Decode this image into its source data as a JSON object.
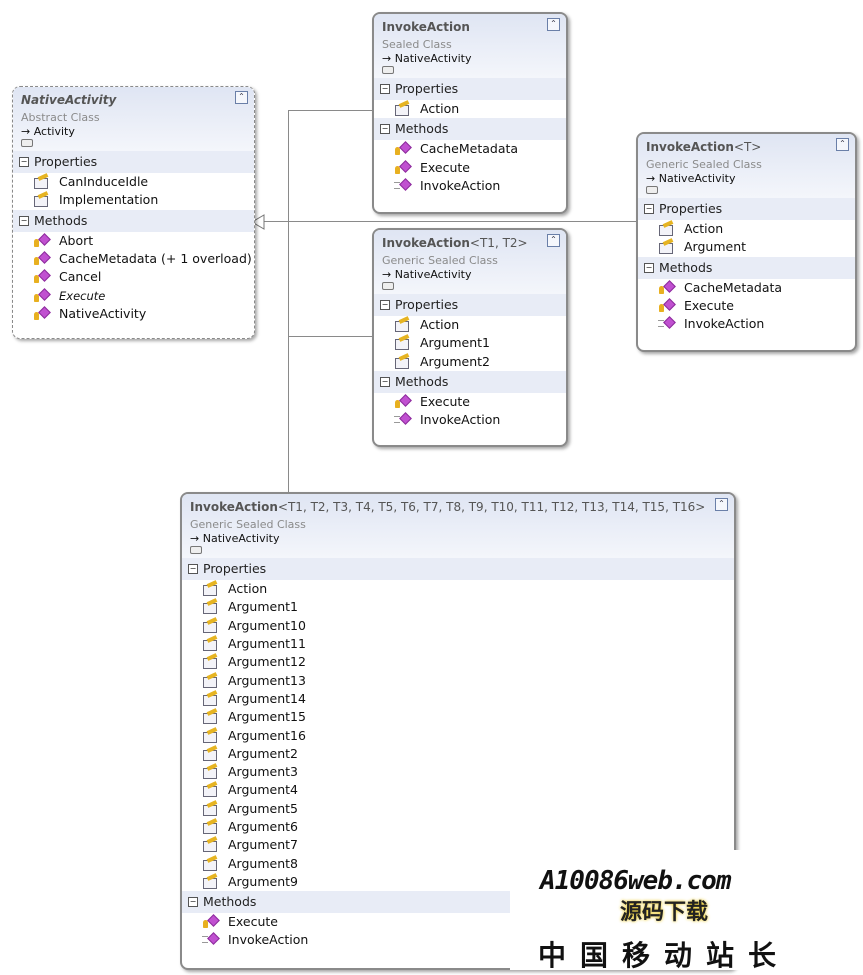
{
  "colors": {
    "border": "#8a8a8a",
    "header_bg": "#dfe5f3",
    "section_bg": "#e8ecf6",
    "method_icon": "#c050d0",
    "property_icon": "#e6b422"
  },
  "collapse_glyph": "⌃",
  "section_toggle_glyph": "−",
  "classes": [
    {
      "id": "native-activity",
      "name": "NativeActivity",
      "type_params": "",
      "italic": true,
      "abstract": true,
      "kind": "Abstract Class",
      "base": "Activity",
      "sections": [
        {
          "label": "Properties",
          "items": [
            {
              "label": "CanInduceIdle",
              "icon": "property-icon"
            },
            {
              "label": "Implementation",
              "icon": "property-icon"
            }
          ]
        },
        {
          "label": "Methods",
          "items": [
            {
              "label": "Abort",
              "icon": "protected-method-icon"
            },
            {
              "label": "CacheMetadata (+ 1 overload)",
              "icon": "protected-method-icon"
            },
            {
              "label": "Cancel",
              "icon": "protected-method-icon"
            },
            {
              "label": "Execute",
              "icon": "protected-method-icon",
              "italic": true
            },
            {
              "label": "NativeActivity",
              "icon": "protected-method-icon"
            }
          ]
        }
      ]
    },
    {
      "id": "invoke-action",
      "name": "InvokeAction",
      "type_params": "",
      "kind": "Sealed Class",
      "base": "NativeActivity",
      "sections": [
        {
          "label": "Properties",
          "items": [
            {
              "label": "Action",
              "icon": "property-icon"
            }
          ]
        },
        {
          "label": "Methods",
          "items": [
            {
              "label": "CacheMetadata",
              "icon": "protected-method-icon"
            },
            {
              "label": "Execute",
              "icon": "protected-method-icon"
            },
            {
              "label": "InvokeAction",
              "icon": "public-method-icon"
            }
          ]
        }
      ]
    },
    {
      "id": "invoke-action-t",
      "name": "InvokeAction",
      "type_params": "<T>",
      "kind": "Generic Sealed Class",
      "base": "NativeActivity",
      "sections": [
        {
          "label": "Properties",
          "items": [
            {
              "label": "Action",
              "icon": "property-icon"
            },
            {
              "label": "Argument",
              "icon": "property-icon"
            }
          ]
        },
        {
          "label": "Methods",
          "items": [
            {
              "label": "CacheMetadata",
              "icon": "protected-method-icon"
            },
            {
              "label": "Execute",
              "icon": "protected-method-icon"
            },
            {
              "label": "InvokeAction",
              "icon": "public-method-icon"
            }
          ]
        }
      ]
    },
    {
      "id": "invoke-action-t1-t2",
      "name": "InvokeAction",
      "type_params": "<T1, T2>",
      "kind": "Generic Sealed Class",
      "base": "NativeActivity",
      "sections": [
        {
          "label": "Properties",
          "items": [
            {
              "label": "Action",
              "icon": "property-icon"
            },
            {
              "label": "Argument1",
              "icon": "property-icon"
            },
            {
              "label": "Argument2",
              "icon": "property-icon"
            }
          ]
        },
        {
          "label": "Methods",
          "items": [
            {
              "label": "Execute",
              "icon": "protected-method-icon"
            },
            {
              "label": "InvokeAction",
              "icon": "public-method-icon"
            }
          ]
        }
      ]
    },
    {
      "id": "invoke-action-t1-t16",
      "name": "InvokeAction",
      "type_params": "<T1, T2, T3, T4, T5, T6, T7, T8, T9, T10, T11, T12, T13, T14, T15, T16>",
      "kind": "Generic Sealed Class",
      "base": "NativeActivity",
      "sections": [
        {
          "label": "Properties",
          "items": [
            {
              "label": "Action",
              "icon": "property-icon"
            },
            {
              "label": "Argument1",
              "icon": "property-icon"
            },
            {
              "label": "Argument10",
              "icon": "property-icon"
            },
            {
              "label": "Argument11",
              "icon": "property-icon"
            },
            {
              "label": "Argument12",
              "icon": "property-icon"
            },
            {
              "label": "Argument13",
              "icon": "property-icon"
            },
            {
              "label": "Argument14",
              "icon": "property-icon"
            },
            {
              "label": "Argument15",
              "icon": "property-icon"
            },
            {
              "label": "Argument16",
              "icon": "property-icon"
            },
            {
              "label": "Argument2",
              "icon": "property-icon"
            },
            {
              "label": "Argument3",
              "icon": "property-icon"
            },
            {
              "label": "Argument4",
              "icon": "property-icon"
            },
            {
              "label": "Argument5",
              "icon": "property-icon"
            },
            {
              "label": "Argument6",
              "icon": "property-icon"
            },
            {
              "label": "Argument7",
              "icon": "property-icon"
            },
            {
              "label": "Argument8",
              "icon": "property-icon"
            },
            {
              "label": "Argument9",
              "icon": "property-icon"
            }
          ]
        },
        {
          "label": "Methods",
          "items": [
            {
              "label": "Execute",
              "icon": "protected-method-icon"
            },
            {
              "label": "InvokeAction",
              "icon": "public-method-icon"
            }
          ]
        }
      ]
    }
  ],
  "watermark": {
    "logo": "A10086web.com",
    "tagline": "源码下载",
    "site": "中国移动站长"
  }
}
